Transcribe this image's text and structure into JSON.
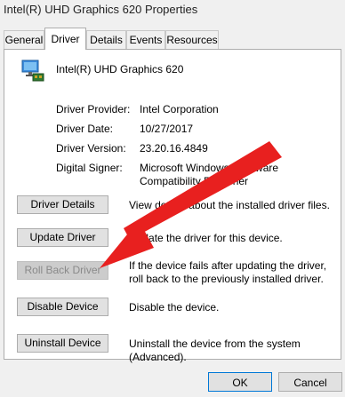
{
  "window": {
    "title": "Intel(R) UHD Graphics 620 Properties"
  },
  "tabs": [
    {
      "label": "General"
    },
    {
      "label": "Driver"
    },
    {
      "label": "Details"
    },
    {
      "label": "Events"
    },
    {
      "label": "Resources"
    }
  ],
  "device": {
    "name": "Intel(R) UHD Graphics 620",
    "icon": "display-adapter-icon"
  },
  "info": {
    "provider_label": "Driver Provider:",
    "provider_value": "Intel Corporation",
    "date_label": "Driver Date:",
    "date_value": "10/27/2017",
    "version_label": "Driver Version:",
    "version_value": "23.20.16.4849",
    "signer_label": "Digital Signer:",
    "signer_value": "Microsoft Windows Hardware Compatibility Publisher"
  },
  "actions": [
    {
      "label": "Driver Details",
      "description": "View details about the installed driver files.",
      "enabled": true
    },
    {
      "label": "Update Driver",
      "description": "Update the driver for this device.",
      "enabled": true
    },
    {
      "label": "Roll Back Driver",
      "description": "If the device fails after updating the driver, roll back to the previously installed driver.",
      "enabled": false
    },
    {
      "label": "Disable Device",
      "description": "Disable the device.",
      "enabled": true
    },
    {
      "label": "Uninstall Device",
      "description": "Uninstall the device from the system (Advanced).",
      "enabled": true
    }
  ],
  "footer": {
    "ok_label": "OK",
    "cancel_label": "Cancel"
  },
  "colors": {
    "annotation_arrow": "#e8201f",
    "focus_border": "#0078d7"
  }
}
